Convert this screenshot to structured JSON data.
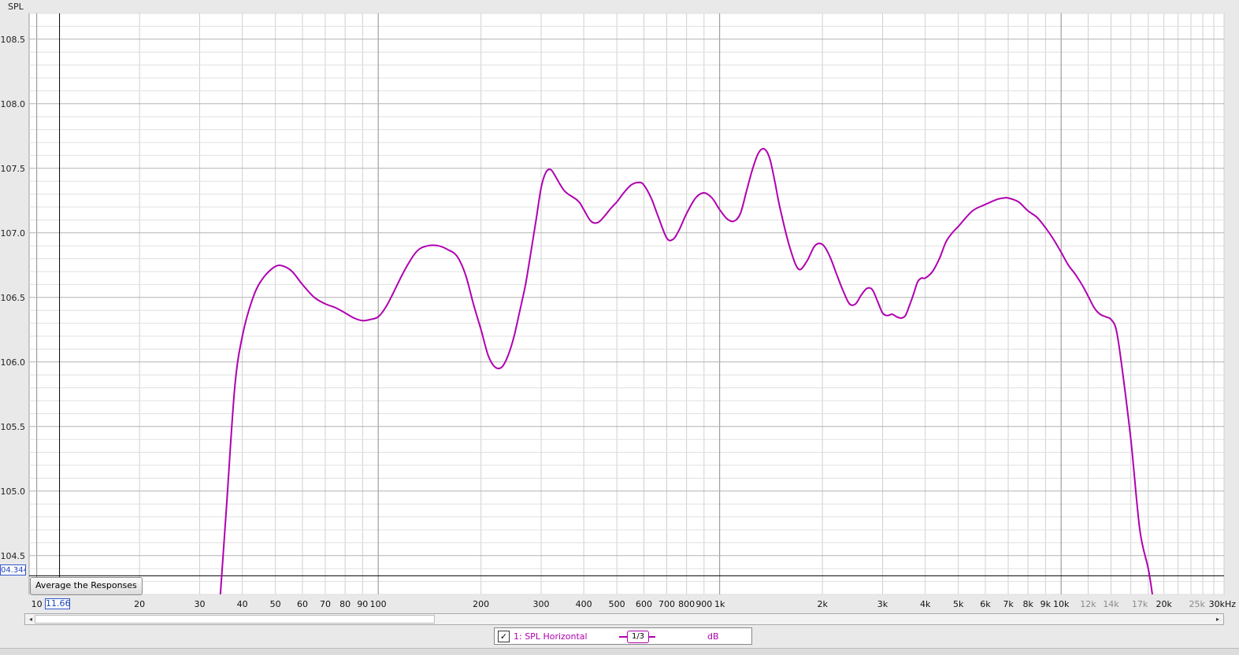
{
  "colors": {
    "trace": "#b000b0",
    "grid_minor": "#d0d0d0",
    "grid_major": "#8c8c8c",
    "cursor": "#000000",
    "plot_background": "#ffffff",
    "cursor_readout": "#2244bb"
  },
  "cursor": {
    "x": "11.66",
    "y": "04.344"
  },
  "button": {
    "average_label": "Average the Responses"
  },
  "legend": {
    "checked": true,
    "check_mark": "✓",
    "name": "1: SPL Horizontal",
    "smoothing": "1/3",
    "unit": "dB"
  },
  "scroll": {
    "left_arrow": "◂",
    "right_arrow": "▸"
  },
  "chart_data": {
    "type": "line",
    "ylabel": "SPL",
    "xlabel": "",
    "x_scale": "log",
    "xlim": [
      9.5,
      30000
    ],
    "ylim": [
      104.2,
      108.7
    ],
    "grid": true,
    "legend_position": "bottom",
    "y_ticks": [
      104.5,
      105.0,
      105.5,
      106.0,
      106.5,
      107.0,
      107.5,
      108.0,
      108.5
    ],
    "y_tick_labels": [
      "104.5",
      "105.0",
      "105.5",
      "106.0",
      "106.5",
      "107.0",
      "107.5",
      "108.0",
      "108.5"
    ],
    "x_ticks": [
      {
        "v": 10,
        "label": "10"
      },
      {
        "v": 20,
        "label": "20"
      },
      {
        "v": 30,
        "label": "30"
      },
      {
        "v": 40,
        "label": "40"
      },
      {
        "v": 50,
        "label": "50"
      },
      {
        "v": 60,
        "label": "60"
      },
      {
        "v": 70,
        "label": "70"
      },
      {
        "v": 80,
        "label": "80"
      },
      {
        "v": 90,
        "label": "90"
      },
      {
        "v": 100,
        "label": "100"
      },
      {
        "v": 200,
        "label": "200"
      },
      {
        "v": 300,
        "label": "300"
      },
      {
        "v": 400,
        "label": "400"
      },
      {
        "v": 500,
        "label": "500"
      },
      {
        "v": 600,
        "label": "600"
      },
      {
        "v": 700,
        "label": "700"
      },
      {
        "v": 800,
        "label": "800"
      },
      {
        "v": 900,
        "label": "900"
      },
      {
        "v": 1000,
        "label": "1k"
      },
      {
        "v": 2000,
        "label": "2k"
      },
      {
        "v": 3000,
        "label": "3k"
      },
      {
        "v": 4000,
        "label": "4k"
      },
      {
        "v": 5000,
        "label": "5k"
      },
      {
        "v": 6000,
        "label": "6k"
      },
      {
        "v": 7000,
        "label": "7k"
      },
      {
        "v": 8000,
        "label": "8k"
      },
      {
        "v": 9000,
        "label": "9k"
      },
      {
        "v": 10000,
        "label": "10k"
      },
      {
        "v": 12000,
        "label": "12k",
        "dim": true
      },
      {
        "v": 14000,
        "label": "14k",
        "dim": true
      },
      {
        "v": 17000,
        "label": "17k",
        "dim": true
      },
      {
        "v": 20000,
        "label": "20k"
      },
      {
        "v": 25000,
        "label": "25k",
        "dim": true
      },
      {
        "v": 30000,
        "label": "30kHz"
      }
    ],
    "series": [
      {
        "x": [
          34.5,
          36,
          38,
          40,
          43,
          46,
          50,
          53,
          56,
          60,
          65,
          70,
          75,
          80,
          85,
          90,
          95,
          100,
          105,
          110,
          120,
          130,
          140,
          150,
          160,
          170,
          180,
          190,
          200,
          210,
          220,
          230,
          240,
          250,
          260,
          270,
          280,
          290,
          300,
          310,
          320,
          330,
          340,
          350,
          360,
          370,
          380,
          390,
          400,
          420,
          440,
          460,
          480,
          500,
          520,
          550,
          580,
          600,
          630,
          660,
          700,
          730,
          760,
          800,
          850,
          900,
          950,
          1000,
          1050,
          1100,
          1150,
          1200,
          1250,
          1300,
          1350,
          1400,
          1450,
          1500,
          1600,
          1700,
          1800,
          1900,
          2000,
          2100,
          2200,
          2300,
          2400,
          2500,
          2600,
          2700,
          2800,
          2900,
          3000,
          3100,
          3200,
          3300,
          3400,
          3500,
          3600,
          3700,
          3800,
          3900,
          4000,
          4200,
          4400,
          4600,
          4800,
          5000,
          5500,
          6000,
          6500,
          6800,
          7000,
          7500,
          8000,
          8500,
          9000,
          9500,
          10000,
          10500,
          11000,
          11500,
          12000,
          12500,
          13000,
          13500,
          14000,
          14500,
          15000,
          16000,
          17000,
          18000,
          18500
        ],
        "y": [
          104.2,
          104.9,
          105.8,
          106.2,
          106.5,
          106.65,
          106.74,
          106.74,
          106.7,
          106.6,
          106.5,
          106.45,
          106.42,
          106.38,
          106.34,
          106.32,
          106.33,
          106.35,
          106.42,
          106.52,
          106.72,
          106.86,
          106.9,
          106.9,
          106.87,
          106.82,
          106.68,
          106.45,
          106.25,
          106.05,
          105.96,
          105.96,
          106.05,
          106.2,
          106.4,
          106.6,
          106.85,
          107.1,
          107.35,
          107.47,
          107.49,
          107.44,
          107.38,
          107.33,
          107.3,
          107.28,
          107.26,
          107.23,
          107.18,
          107.09,
          107.08,
          107.13,
          107.19,
          107.24,
          107.3,
          107.37,
          107.39,
          107.37,
          107.27,
          107.13,
          106.96,
          106.95,
          107.02,
          107.15,
          107.27,
          107.31,
          107.27,
          107.18,
          107.11,
          107.09,
          107.15,
          107.33,
          107.5,
          107.62,
          107.65,
          107.58,
          107.4,
          107.2,
          106.9,
          106.72,
          106.78,
          106.9,
          106.91,
          106.82,
          106.68,
          106.55,
          106.45,
          106.45,
          106.52,
          106.57,
          106.56,
          106.47,
          106.38,
          106.36,
          106.37,
          106.35,
          106.34,
          106.36,
          106.44,
          106.53,
          106.62,
          106.65,
          106.65,
          106.7,
          106.8,
          106.93,
          107.0,
          107.05,
          107.17,
          107.22,
          107.26,
          107.27,
          107.27,
          107.24,
          107.17,
          107.12,
          107.04,
          106.95,
          106.85,
          106.75,
          106.68,
          106.6,
          106.51,
          106.42,
          106.37,
          106.35,
          106.33,
          106.25,
          106.0,
          105.4,
          104.7,
          104.4,
          104.2
        ]
      }
    ]
  }
}
